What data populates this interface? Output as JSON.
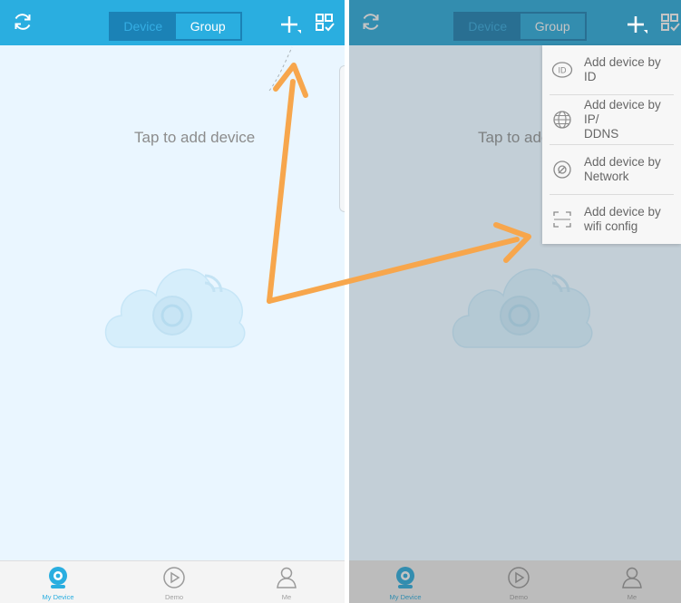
{
  "colors": {
    "primary": "#2aaee0",
    "segment_active": "#1b82b6",
    "content_bg": "#eaf6ff",
    "annotation_arrow": "#f7a64c"
  },
  "left_screen": {
    "header": {
      "refresh_icon": "refresh-icon",
      "tabs": [
        {
          "label": "Device",
          "active": true
        },
        {
          "label": "Group",
          "active": false
        }
      ],
      "add_icon": "plus-icon",
      "scan_icon": "qr-scan-icon"
    },
    "hint": "Tap to add device",
    "bottom_nav": [
      {
        "label": "My Device",
        "icon": "camera-icon",
        "active": true
      },
      {
        "label": "Demo",
        "icon": "play-icon",
        "active": false
      },
      {
        "label": "Me",
        "icon": "user-icon",
        "active": false
      }
    ]
  },
  "right_screen": {
    "header": {
      "tabs": [
        {
          "label": "Device",
          "active": true
        },
        {
          "label": "Group",
          "active": false
        }
      ]
    },
    "hint": "Tap to add device",
    "menu": [
      {
        "label": "Add device by ID",
        "icon": "id-icon"
      },
      {
        "label": "Add device by IP/\nDDNS",
        "icon": "globe-icon"
      },
      {
        "label": "Add device by\nNetwork",
        "icon": "network-icon"
      },
      {
        "label": "Add device by\nwifi config",
        "icon": "scan-frame-icon"
      }
    ],
    "bottom_nav": [
      {
        "label": "My Device",
        "active": true
      },
      {
        "label": "Demo",
        "active": false
      },
      {
        "label": "Me",
        "active": false
      }
    ]
  }
}
